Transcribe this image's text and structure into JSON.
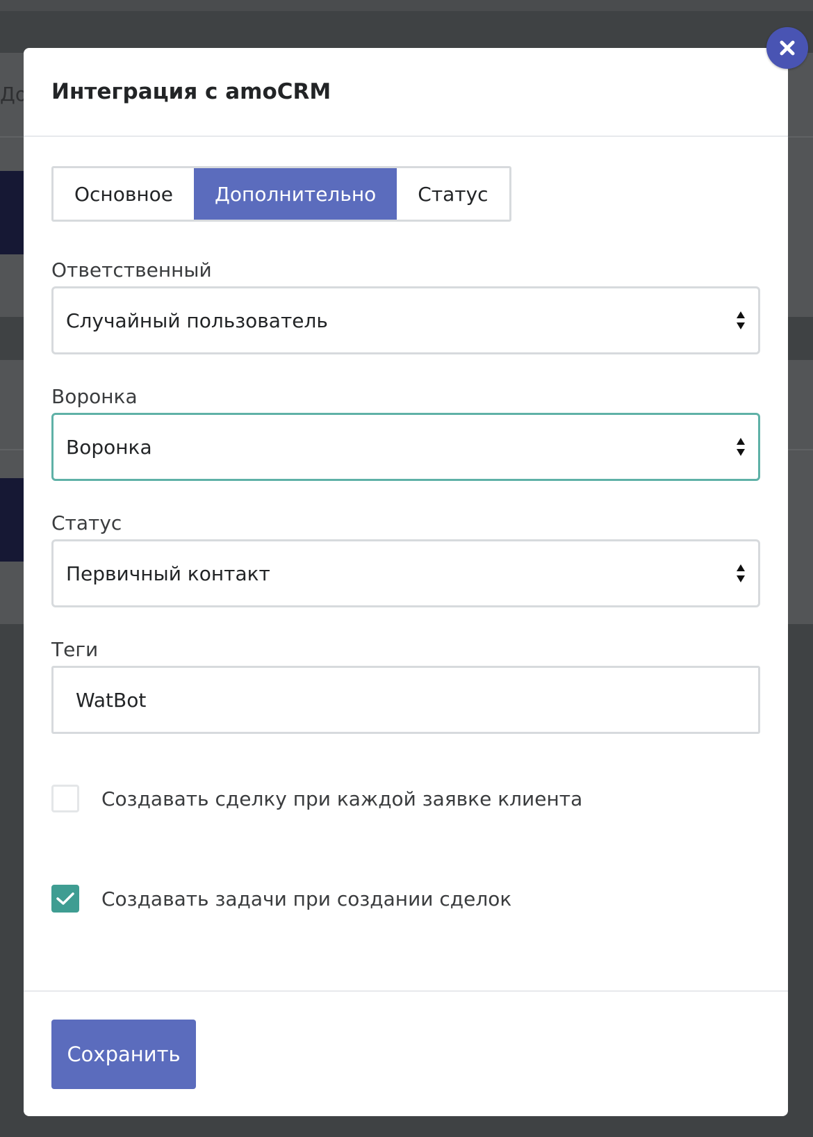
{
  "background": {
    "partial_text": "До"
  },
  "modal": {
    "title": "Интеграция с amoCRM",
    "close_icon": "close-icon",
    "tabs": [
      {
        "label": "Основное",
        "active": false
      },
      {
        "label": "Дополнительно",
        "active": true
      },
      {
        "label": "Статус",
        "active": false
      }
    ],
    "fields": {
      "responsible": {
        "label": "Ответственный",
        "value": "Случайный пользователь"
      },
      "funnel": {
        "label": "Воронка",
        "value": "Воронка"
      },
      "status": {
        "label": "Статус",
        "value": "Первичный контакт"
      },
      "tags": {
        "label": "Теги",
        "value": "WatBot"
      }
    },
    "checkboxes": [
      {
        "label": "Создавать сделку при каждой заявке клиента",
        "checked": false
      },
      {
        "label": "Создавать задачи при создании сделок",
        "checked": true
      }
    ],
    "save_label": "Сохранить"
  },
  "colors": {
    "accent": "#5b6cbd",
    "close_button": "#4954b3",
    "focus_border": "#5fb1a7",
    "checkbox_checked": "#3f9d92",
    "overlay": "#3f4244"
  }
}
